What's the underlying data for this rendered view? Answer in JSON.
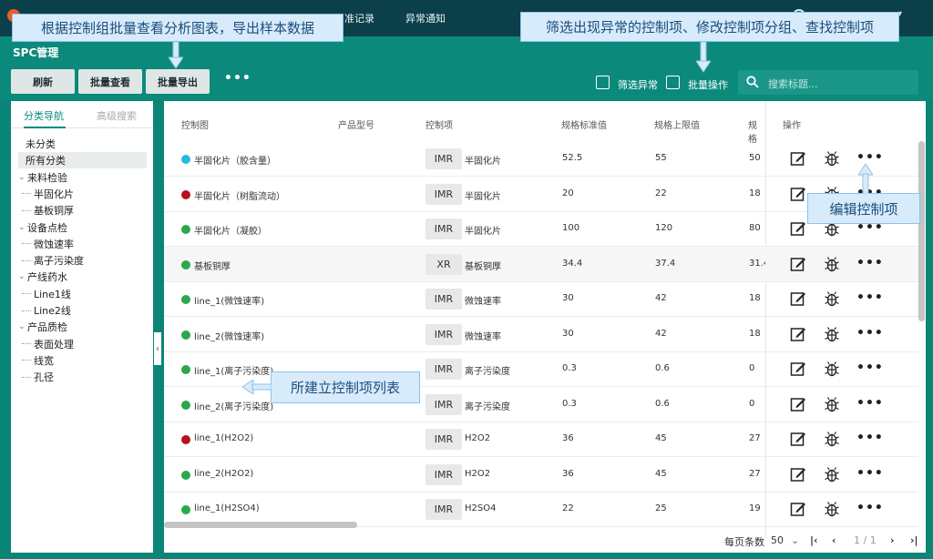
{
  "topnav": {
    "items": [
      "准记录",
      "异常通知"
    ]
  },
  "header": {
    "title": "SPC管理",
    "buttons": {
      "refresh": "刷新",
      "batch_view": "批量查看",
      "batch_export": "批量导出",
      "more": "•••"
    },
    "filter_abnormal": "筛选异常",
    "batch_ops": "批量操作",
    "search_placeholder": "搜索标题..."
  },
  "sidebar": {
    "tabs": [
      "分类导航",
      "高级搜索"
    ],
    "tree": [
      {
        "label": "未分类",
        "level": 0,
        "group": false
      },
      {
        "label": "所有分类",
        "level": 0,
        "group": false,
        "selected": true
      },
      {
        "label": "来料检验",
        "level": 0,
        "group": true
      },
      {
        "label": "半固化片",
        "level": 1
      },
      {
        "label": "基板铜厚",
        "level": 1
      },
      {
        "label": "设备点检",
        "level": 0,
        "group": true
      },
      {
        "label": "微蚀速率",
        "level": 1
      },
      {
        "label": "离子污染度",
        "level": 1
      },
      {
        "label": "产线药水",
        "level": 0,
        "group": true
      },
      {
        "label": "Line1线",
        "level": 1
      },
      {
        "label": "Line2线",
        "level": 1
      },
      {
        "label": "产品质检",
        "level": 0,
        "group": true
      },
      {
        "label": "表面处理",
        "level": 1
      },
      {
        "label": "线宽",
        "level": 1
      },
      {
        "label": "孔径",
        "level": 1
      }
    ]
  },
  "table": {
    "columns": [
      "控制图",
      "产品型号",
      "控制项",
      "规格标准值",
      "规格上限值",
      "规格",
      "操作"
    ],
    "rows": [
      {
        "status": "#2bb8e0",
        "name": "半固化片（胶含量）",
        "model": "",
        "type": "IMR",
        "item": "半固化片",
        "std": "52.5",
        "upper": "55",
        "spec": "50"
      },
      {
        "status": "#b5121b",
        "name": "半固化片（树脂流动）",
        "model": "",
        "type": "IMR",
        "item": "半固化片",
        "std": "20",
        "upper": "22",
        "spec": "18"
      },
      {
        "status": "#2aa84a",
        "name": "半固化片（凝胶）",
        "model": "",
        "type": "IMR",
        "item": "半固化片",
        "std": "100",
        "upper": "120",
        "spec": "80"
      },
      {
        "status": "#2aa84a",
        "name": "基板铜厚",
        "model": "",
        "type": "XR",
        "item": "基板铜厚",
        "std": "34.4",
        "upper": "37.4",
        "spec": "31.4"
      },
      {
        "status": "#2aa84a",
        "name": "line_1(微蚀速率)",
        "model": "",
        "type": "IMR",
        "item": "微蚀速率",
        "std": "30",
        "upper": "42",
        "spec": "18"
      },
      {
        "status": "#2aa84a",
        "name": "line_2(微蚀速率)",
        "model": "",
        "type": "IMR",
        "item": "微蚀速率",
        "std": "30",
        "upper": "42",
        "spec": "18"
      },
      {
        "status": "#2aa84a",
        "name": "line_1(离子污染度)",
        "model": "",
        "type": "IMR",
        "item": "离子污染度",
        "std": "0.3",
        "upper": "0.6",
        "spec": "0"
      },
      {
        "status": "#2aa84a",
        "name": "line_2(离子污染度)",
        "model": "",
        "type": "IMR",
        "item": "离子污染度",
        "std": "0.3",
        "upper": "0.6",
        "spec": "0"
      },
      {
        "status": "#b5121b",
        "name": "line_1(H2O2)",
        "model": "",
        "type": "IMR",
        "item": "H2O2",
        "std": "36",
        "upper": "45",
        "spec": "27"
      },
      {
        "status": "#2aa84a",
        "name": "line_2(H2O2)",
        "model": "",
        "type": "IMR",
        "item": "H2O2",
        "std": "36",
        "upper": "45",
        "spec": "27"
      },
      {
        "status": "#2aa84a",
        "name": "line_1(H2SO4)",
        "model": "",
        "type": "IMR",
        "item": "H2SO4",
        "std": "22",
        "upper": "25",
        "spec": "19"
      }
    ]
  },
  "pager": {
    "per_page_label": "每页条数",
    "per_page": "50",
    "page": "1 / 1"
  },
  "callouts": {
    "batch": "根据控制组批量查看分析图表，导出样本数据",
    "filter": "筛选出现异常的控制项、修改控制项分组、查找控制项",
    "edit": "编辑控制项",
    "list": "所建立控制项列表"
  },
  "colors": {
    "primary": "#0b8a7c",
    "nav": "#0b3f4a",
    "callout_bg": "#d8ebfb"
  }
}
